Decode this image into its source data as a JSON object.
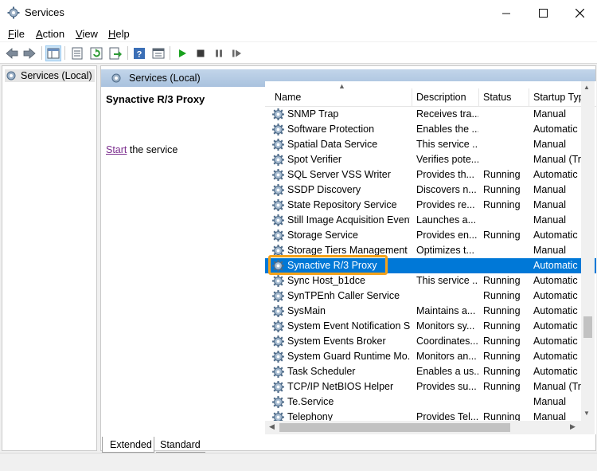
{
  "window": {
    "title": "Services"
  },
  "menu": [
    {
      "label": "File",
      "key": "F",
      "rest": "ile"
    },
    {
      "label": "Action",
      "key": "A",
      "rest": "ction"
    },
    {
      "label": "View",
      "key": "V",
      "rest": "iew"
    },
    {
      "label": "Help",
      "key": "H",
      "rest": "elp"
    }
  ],
  "tree": {
    "label": "Services (Local)"
  },
  "pane_header": {
    "label": "Services (Local)"
  },
  "selected_service": {
    "title": "Synactive R/3 Proxy",
    "action_link": "Start",
    "action_rest": " the service"
  },
  "columns": {
    "name": "Name",
    "description": "Description",
    "status": "Status",
    "startup": "Startup Typ"
  },
  "services": [
    {
      "name": "SNMP Trap",
      "description": "Receives tra...",
      "status": "",
      "startup": "Manual"
    },
    {
      "name": "Software Protection",
      "description": "Enables the ...",
      "status": "",
      "startup": "Automatic"
    },
    {
      "name": "Spatial Data Service",
      "description": "This service ...",
      "status": "",
      "startup": "Manual"
    },
    {
      "name": "Spot Verifier",
      "description": "Verifies pote...",
      "status": "",
      "startup": "Manual (Tri"
    },
    {
      "name": "SQL Server VSS Writer",
      "description": "Provides th...",
      "status": "Running",
      "startup": "Automatic"
    },
    {
      "name": "SSDP Discovery",
      "description": "Discovers n...",
      "status": "Running",
      "startup": "Manual"
    },
    {
      "name": "State Repository Service",
      "description": "Provides re...",
      "status": "Running",
      "startup": "Manual"
    },
    {
      "name": "Still Image Acquisition Events",
      "description": "Launches a...",
      "status": "",
      "startup": "Manual"
    },
    {
      "name": "Storage Service",
      "description": "Provides en...",
      "status": "Running",
      "startup": "Automatic"
    },
    {
      "name": "Storage Tiers Management",
      "description": "Optimizes t...",
      "status": "",
      "startup": "Manual"
    },
    {
      "name": "Synactive R/3 Proxy",
      "description": "",
      "status": "",
      "startup": "Automatic",
      "selected": true
    },
    {
      "name": "Sync Host_b1dce",
      "description": "This service ...",
      "status": "Running",
      "startup": "Automatic"
    },
    {
      "name": "SynTPEnh Caller Service",
      "description": "",
      "status": "Running",
      "startup": "Automatic"
    },
    {
      "name": "SysMain",
      "description": "Maintains a...",
      "status": "Running",
      "startup": "Automatic"
    },
    {
      "name": "System Event Notification S...",
      "description": "Monitors sy...",
      "status": "Running",
      "startup": "Automatic"
    },
    {
      "name": "System Events Broker",
      "description": "Coordinates...",
      "status": "Running",
      "startup": "Automatic"
    },
    {
      "name": "System Guard Runtime Mo...",
      "description": "Monitors an...",
      "status": "Running",
      "startup": "Automatic"
    },
    {
      "name": "Task Scheduler",
      "description": "Enables a us...",
      "status": "Running",
      "startup": "Automatic"
    },
    {
      "name": "TCP/IP NetBIOS Helper",
      "description": "Provides su...",
      "status": "Running",
      "startup": "Manual (Tri"
    },
    {
      "name": "Te.Service",
      "description": "",
      "status": "",
      "startup": "Manual"
    },
    {
      "name": "Telephony",
      "description": "Provides Tel...",
      "status": "Running",
      "startup": "Manual"
    }
  ],
  "tabs": {
    "extended": "Extended",
    "standard": "Standard"
  },
  "colors": {
    "selection": "#0078d7",
    "highlight_outline": "#f4a21a",
    "header_gradient": "#b6cbe4"
  },
  "icons": [
    "gear-icon",
    "back-icon",
    "forward-icon",
    "console-tree-icon",
    "properties-icon",
    "refresh-icon",
    "export-icon",
    "help-icon",
    "view-icon",
    "play-icon",
    "stop-icon",
    "pause-icon",
    "restart-icon"
  ]
}
